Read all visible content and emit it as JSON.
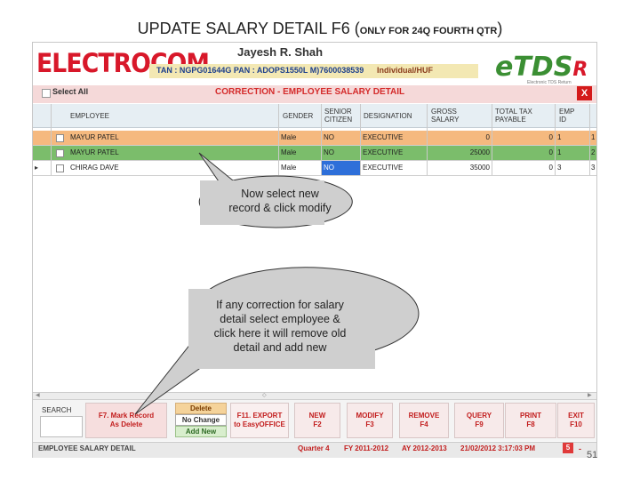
{
  "slide": {
    "title_main": "UPDATE SALARY DETAIL F6 (",
    "title_small": "ONLY FOR 24Q FOURTH QTR",
    "title_end": ")",
    "page_number": "51"
  },
  "header": {
    "logo_text": "ELECTROCOM",
    "company_name": "Jayesh R. Shah",
    "tan_pan": "TAN : NGPG01644G PAN : ADOPS1550L  M)7600038539",
    "user_type": "Individual/HUF",
    "etds_logo": "eTDS",
    "etds_logo_r": "R",
    "etds_sub": "Electronic TDS Return"
  },
  "correction_bar": {
    "select_all": "Select All",
    "title": "CORRECTION - EMPLOYEE SALARY DETAIL",
    "close": "X"
  },
  "grid": {
    "columns": [
      "EMPLOYEE",
      "GENDER",
      "SENIOR CITIZEN",
      "DESIGNATION",
      "GROSS SALARY",
      "TOTAL TAX PAYABLE",
      "EMP ID"
    ],
    "rows": [
      {
        "employee": "MAYUR PATEL",
        "gender": "Male",
        "senior": "NO",
        "designation": "EXECUTIVE",
        "gross": "0",
        "tax": "0",
        "emp_id": "1",
        "extra": "1"
      },
      {
        "employee": "MAYUR PATEL",
        "gender": "Male",
        "senior": "NO",
        "designation": "EXECUTIVE",
        "gross": "25000",
        "tax": "0",
        "emp_id": "1",
        "extra": "2"
      },
      {
        "employee": "CHIRAG DAVE",
        "gender": "Male",
        "senior": "NO",
        "designation": "EXECUTIVE",
        "gross": "35000",
        "tax": "0",
        "emp_id": "3",
        "extra": "3"
      }
    ],
    "row_indicator": "▸"
  },
  "toolbar": {
    "search_label": "SEARCH",
    "mark_record": [
      "F7. Mark Record",
      "As Delete"
    ],
    "delete": "Delete",
    "no_change": "No Change",
    "add_new": "Add New",
    "export": [
      "F11. EXPORT",
      "to EasyOFFICE"
    ],
    "new": [
      "NEW",
      "F2"
    ],
    "modify": [
      "MODIFY",
      "F3"
    ],
    "remove": [
      "REMOVE",
      "F4"
    ],
    "query": [
      "QUERY",
      "F9"
    ],
    "print": [
      "PRINT",
      "F8"
    ],
    "exit": [
      "EXIT",
      "F10"
    ]
  },
  "status_bar": {
    "left": "EMPLOYEE SALARY DETAIL",
    "quarter": "Quarter 4",
    "fy": "FY 2011-2012",
    "ay": "AY 2012-2013",
    "datetime": "21/02/2012 3:17:03 PM",
    "num": "5",
    "dash": "-"
  },
  "callouts": {
    "first": [
      "Now  select new",
      "record & click modify"
    ],
    "second": [
      "If any correction for salary",
      "detail select employee &",
      "click here it will remove old",
      "detail and add new"
    ]
  },
  "colors": {
    "row_selected": "#f5b97f",
    "row_green": "#7bbd6b",
    "row_blue_cell": "#2e6fd9",
    "accent_red": "#d42a2a"
  }
}
